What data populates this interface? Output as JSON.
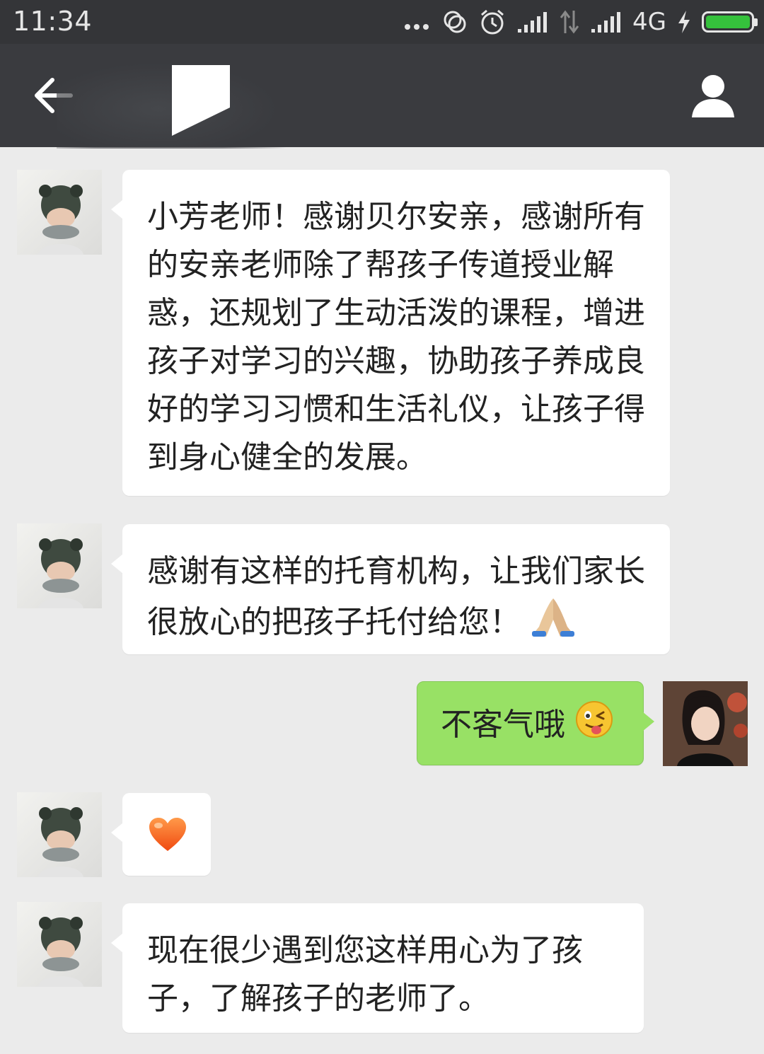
{
  "status_bar": {
    "time": "11:34",
    "network": "4G",
    "icons": [
      "more-dots-icon",
      "sync-icon",
      "alarm-icon",
      "signal-icon",
      "data-arrows-icon",
      "signal-icon",
      "charging-icon",
      "battery-icon"
    ],
    "battery_color": "#35c13c"
  },
  "header": {
    "title": "",
    "back_icon": "arrow-left-icon",
    "profile_icon": "person-icon"
  },
  "colors": {
    "chat_background": "#ebebeb",
    "header_background": "#3a3b3f",
    "incoming_bubble": "#ffffff",
    "outgoing_bubble": "#98e165"
  },
  "messages": [
    {
      "direction": "incoming",
      "text": "小芳老师！感谢贝尔安亲，感谢所有的安亲老师除了帮孩子传道授业解惑，还规划了生动活泼的课程，增进孩子对学习的兴趣，协助孩子养成良好的学习习惯和生活礼仪，让孩子得到身心健全的发展。"
    },
    {
      "direction": "incoming",
      "text": "感谢有这样的托育机构，让我们家长很放心的把孩子托付给您！",
      "emoji": "folded-hands-emoji"
    },
    {
      "direction": "outgoing",
      "text": "不客气哦",
      "emoji": "winking-tongue-emoji"
    },
    {
      "direction": "incoming",
      "text": "",
      "emoji": "orange-heart-emoji"
    },
    {
      "direction": "incoming",
      "text": "现在很少遇到您这样用心为了孩子，了解孩子的老师了。"
    }
  ]
}
